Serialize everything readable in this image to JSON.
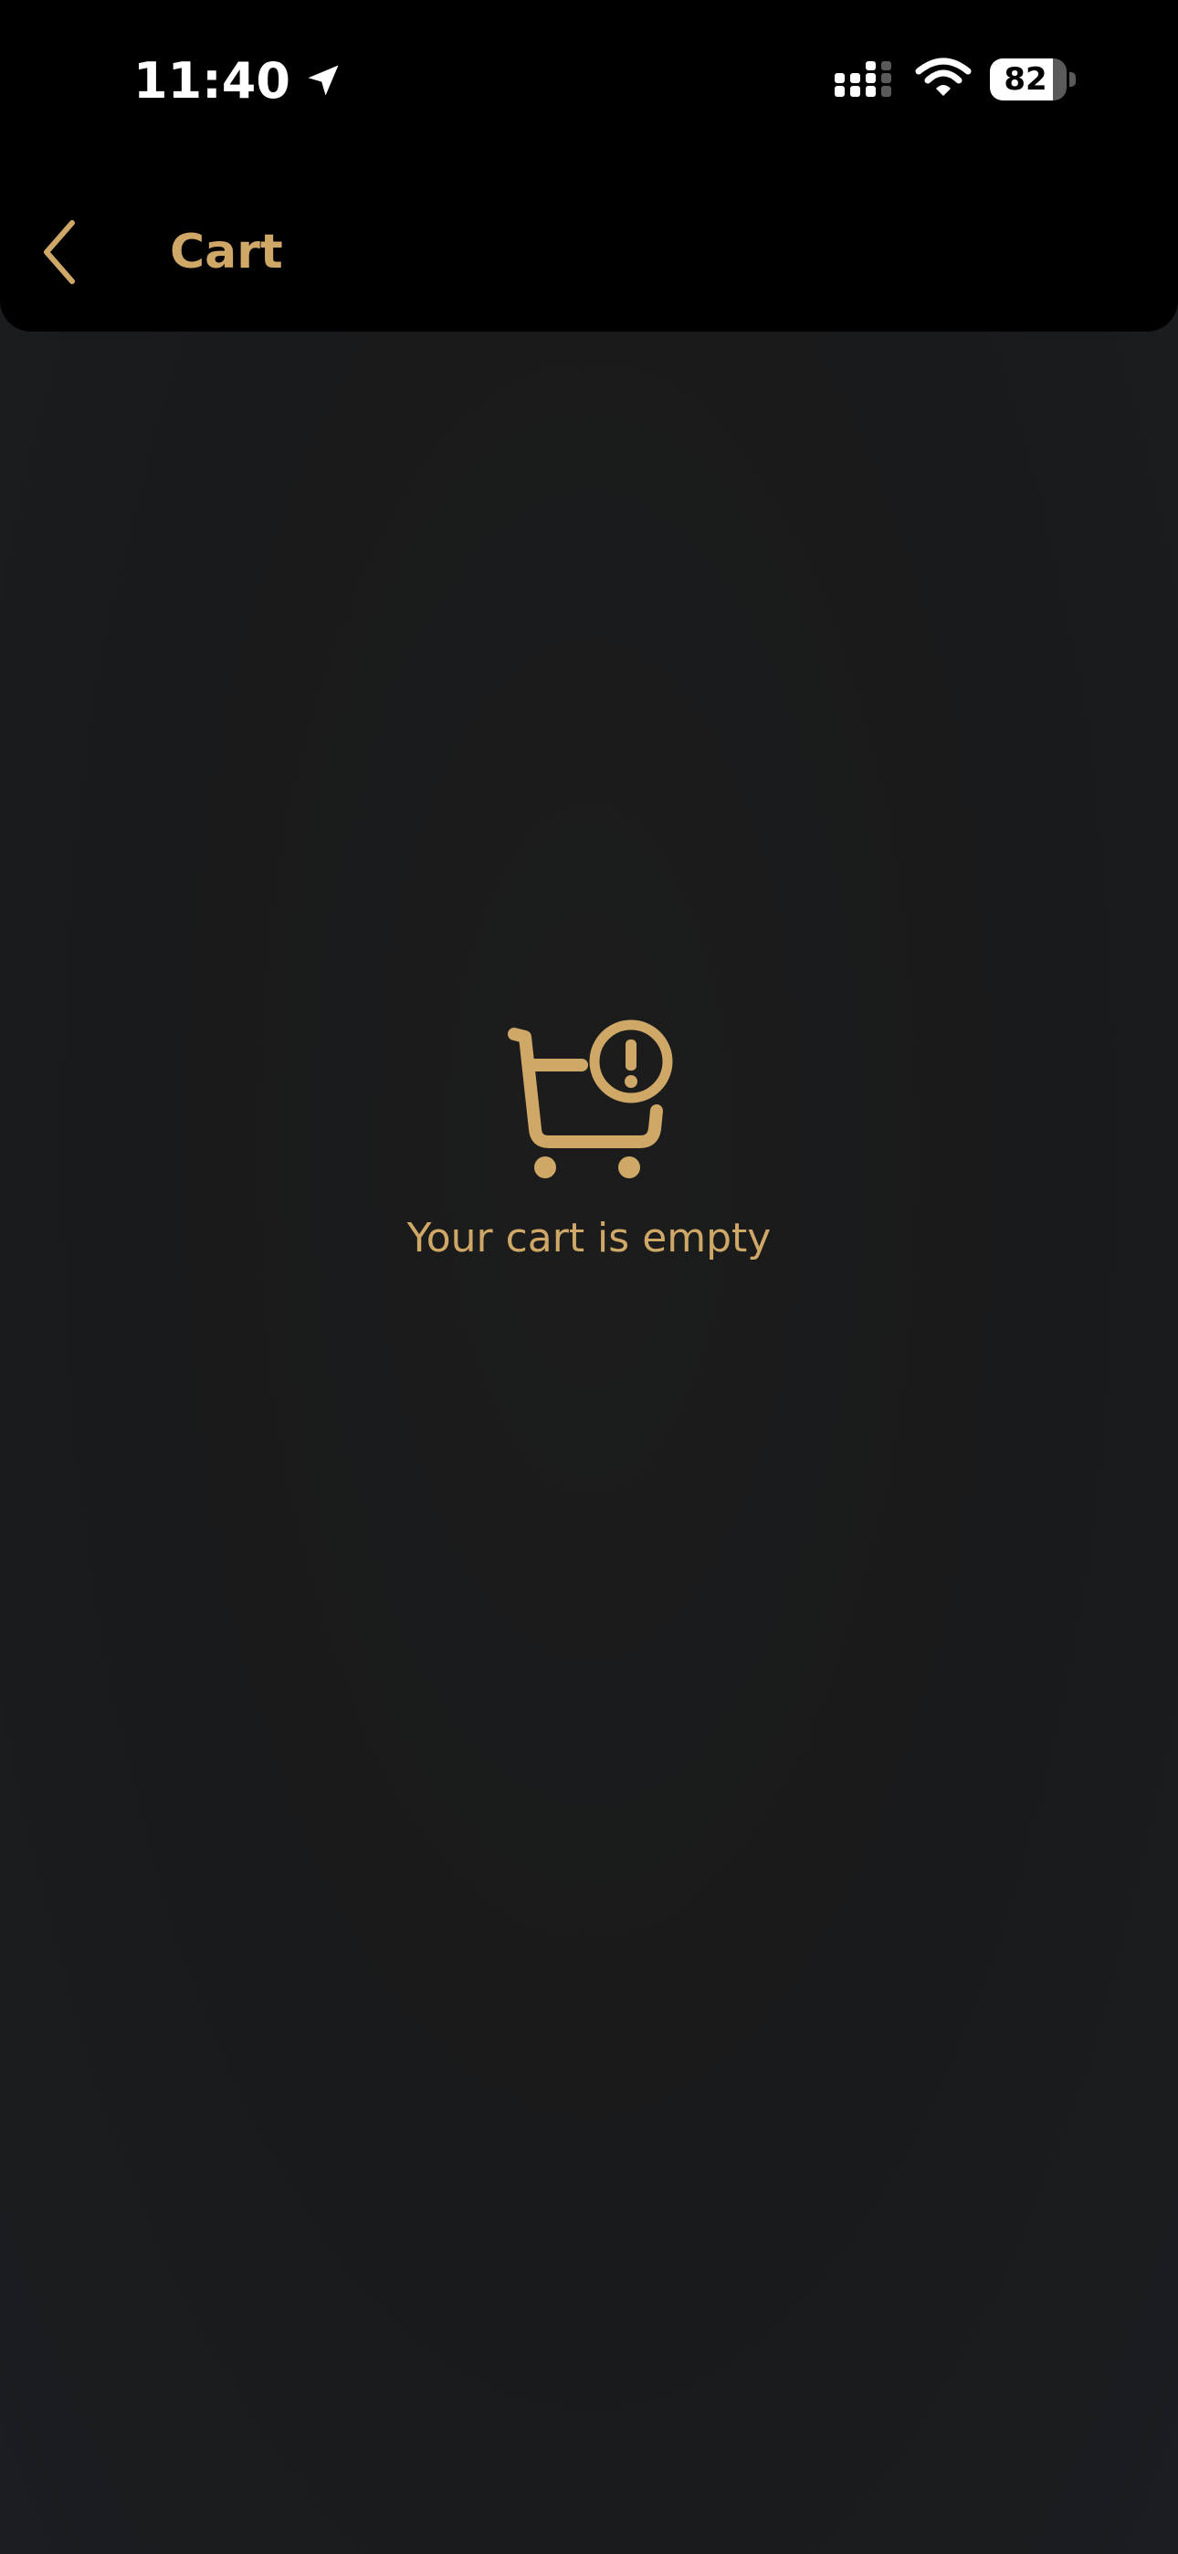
{
  "status_bar": {
    "time": "11:40",
    "battery_level": "82",
    "icons": [
      "location-arrow-icon",
      "cellular-signal-icon",
      "wifi-icon",
      "battery-icon"
    ]
  },
  "header": {
    "back_icon": "chevron-left-icon",
    "title": "Cart"
  },
  "empty_state": {
    "icon": "cart-alert-icon",
    "message": "Your cart is empty"
  },
  "colors": {
    "accent": "#cfa867",
    "header_background": "#000000",
    "page_background": "#1b1b1b",
    "status_text": "#ffffff"
  }
}
